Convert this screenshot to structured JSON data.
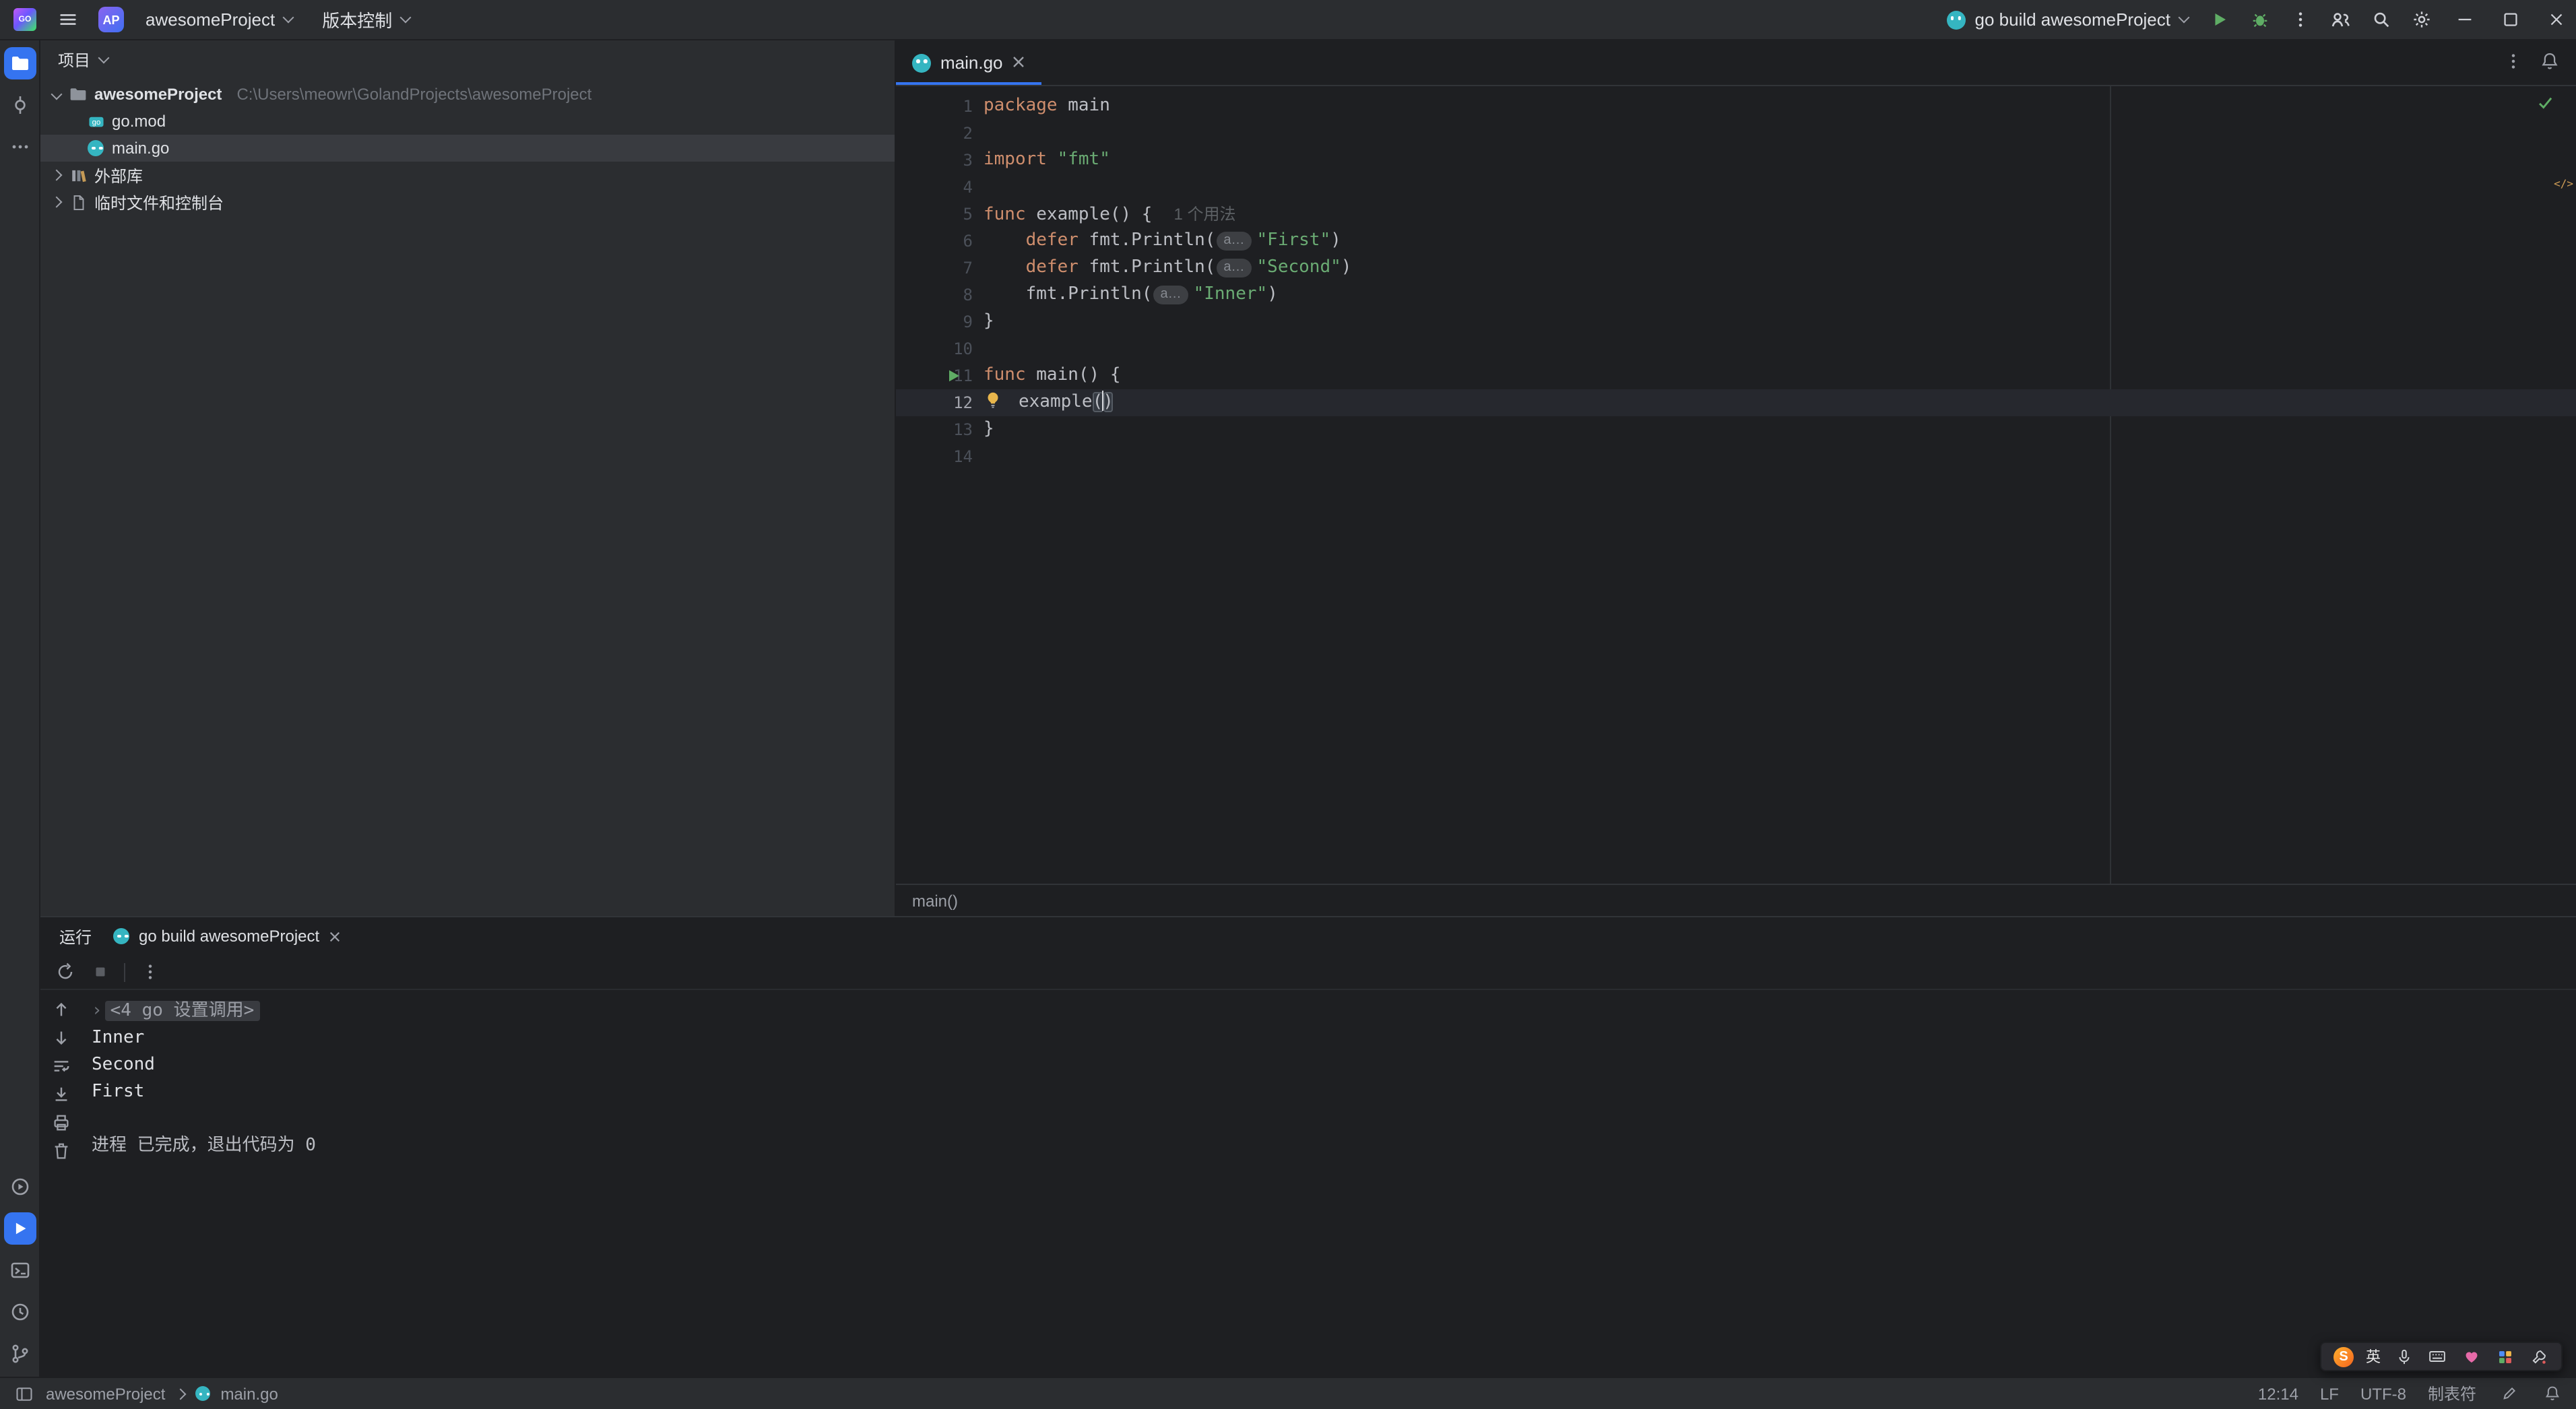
{
  "titlebar": {
    "project_badge": "AP",
    "project_name": "awesomeProject",
    "vcs_label": "版本控制",
    "run_config_label": "go build awesomeProject"
  },
  "project_panel": {
    "header": "项目",
    "tree": [
      {
        "type": "root",
        "label": "awesomeProject",
        "path": "C:\\Users\\meowr\\GolandProjects\\awesomeProject",
        "expanded": true
      },
      {
        "type": "gomod",
        "label": "go.mod",
        "child": true
      },
      {
        "type": "gofile",
        "label": "main.go",
        "child": true,
        "selected": true
      },
      {
        "type": "lib",
        "label": "外部库",
        "collapsed": true
      },
      {
        "type": "scratch",
        "label": "临时文件和控制台",
        "collapsed": true
      }
    ]
  },
  "editor": {
    "tab_label": "main.go",
    "breadcrumb": "main()",
    "cursor_position_label": "12:14",
    "code": [
      {
        "n": 1,
        "tokens": [
          [
            "kw",
            "package"
          ],
          [
            "pl",
            " main"
          ]
        ]
      },
      {
        "n": 2,
        "tokens": []
      },
      {
        "n": 3,
        "tokens": [
          [
            "kw",
            "import"
          ],
          [
            "pl",
            " "
          ],
          [
            "str",
            "\"fmt\""
          ]
        ]
      },
      {
        "n": 4,
        "tokens": []
      },
      {
        "n": 5,
        "tokens": [
          [
            "kw",
            "func"
          ],
          [
            "pl",
            " example() {"
          ],
          [
            "hint",
            "1 个用法"
          ]
        ]
      },
      {
        "n": 6,
        "tokens": [
          [
            "pl",
            "    "
          ],
          [
            "kw",
            "defer"
          ],
          [
            "pl",
            " fmt.Println("
          ],
          [
            "ph",
            "a…"
          ],
          [
            "str",
            "\"First\""
          ],
          [
            "pl",
            ")"
          ]
        ]
      },
      {
        "n": 7,
        "tokens": [
          [
            "pl",
            "    "
          ],
          [
            "kw",
            "defer"
          ],
          [
            "pl",
            " fmt.Println("
          ],
          [
            "ph",
            "a…"
          ],
          [
            "str",
            "\"Second\""
          ],
          [
            "pl",
            ")"
          ]
        ]
      },
      {
        "n": 8,
        "tokens": [
          [
            "pl",
            "    fmt.Println("
          ],
          [
            "ph",
            "a…"
          ],
          [
            "str",
            "\"Inner\""
          ],
          [
            "pl",
            ")"
          ]
        ]
      },
      {
        "n": 9,
        "tokens": [
          [
            "pl",
            "}"
          ]
        ]
      },
      {
        "n": 10,
        "tokens": []
      },
      {
        "n": 11,
        "run": true,
        "tokens": [
          [
            "kw",
            "func"
          ],
          [
            "pl",
            " main() {"
          ]
        ]
      },
      {
        "n": 12,
        "active": true,
        "bulb": true,
        "tokens": [
          [
            "pl",
            "example"
          ],
          [
            "br",
            "("
          ],
          [
            "caret",
            ""
          ],
          [
            "br",
            ")"
          ]
        ]
      },
      {
        "n": 13,
        "tokens": [
          [
            "pl",
            "}"
          ]
        ]
      },
      {
        "n": 14,
        "tokens": []
      }
    ]
  },
  "run_panel": {
    "tool_label": "运行",
    "tab_label": "go build awesomeProject",
    "console": [
      {
        "type": "fold",
        "text": "<4 go 设置调用>"
      },
      {
        "type": "out",
        "text": "Inner"
      },
      {
        "type": "out",
        "text": "Second"
      },
      {
        "type": "out",
        "text": "First"
      },
      {
        "type": "blank",
        "text": ""
      },
      {
        "type": "sys",
        "text": "进程 已完成，退出代码为 0"
      }
    ]
  },
  "statusbar": {
    "nav_project": "awesomeProject",
    "nav_file": "main.go",
    "cursor": "12:14",
    "line_ending": "LF",
    "encoding": "UTF-8",
    "indent": "制表符"
  },
  "ime": {
    "mode": "英"
  },
  "icons": {
    "goland-logo-icon": "gradient square GO",
    "main-menu-icon": "hamburger",
    "go-icon": "teal gopher circle",
    "run-icon": "green triangle",
    "debug-icon": "green bug",
    "more-icon": "kebab dots",
    "code-with-me-icon": "two users",
    "search-icon": "magnifier",
    "settings-icon": "gear",
    "minimize-icon": "line",
    "maximize-icon": "square",
    "close-icon": "x",
    "project-tool-icon": "folder on blue",
    "commit-icon": "circle with lines",
    "terminal-icon": "prompt box",
    "git-branch-icon": "branch nodes",
    "notifications-icon": "bell",
    "inspection-ok-icon": "green check",
    "lightbulb-icon": "yellow bulb",
    "rerun-icon": "circular arrow",
    "stop-icon": "square",
    "soft-wrap-icon": "wrapped lines",
    "scroll-end-icon": "arrow to line",
    "print-icon": "printer",
    "clear-icon": "trash",
    "sogou-logo-icon": "orange S",
    "mic-icon": "microphone",
    "keyboard-icon": "keyboard",
    "heart-icon": "pink heart",
    "toolbox-icon": "colored grid",
    "wrench-icon": "wrench"
  }
}
